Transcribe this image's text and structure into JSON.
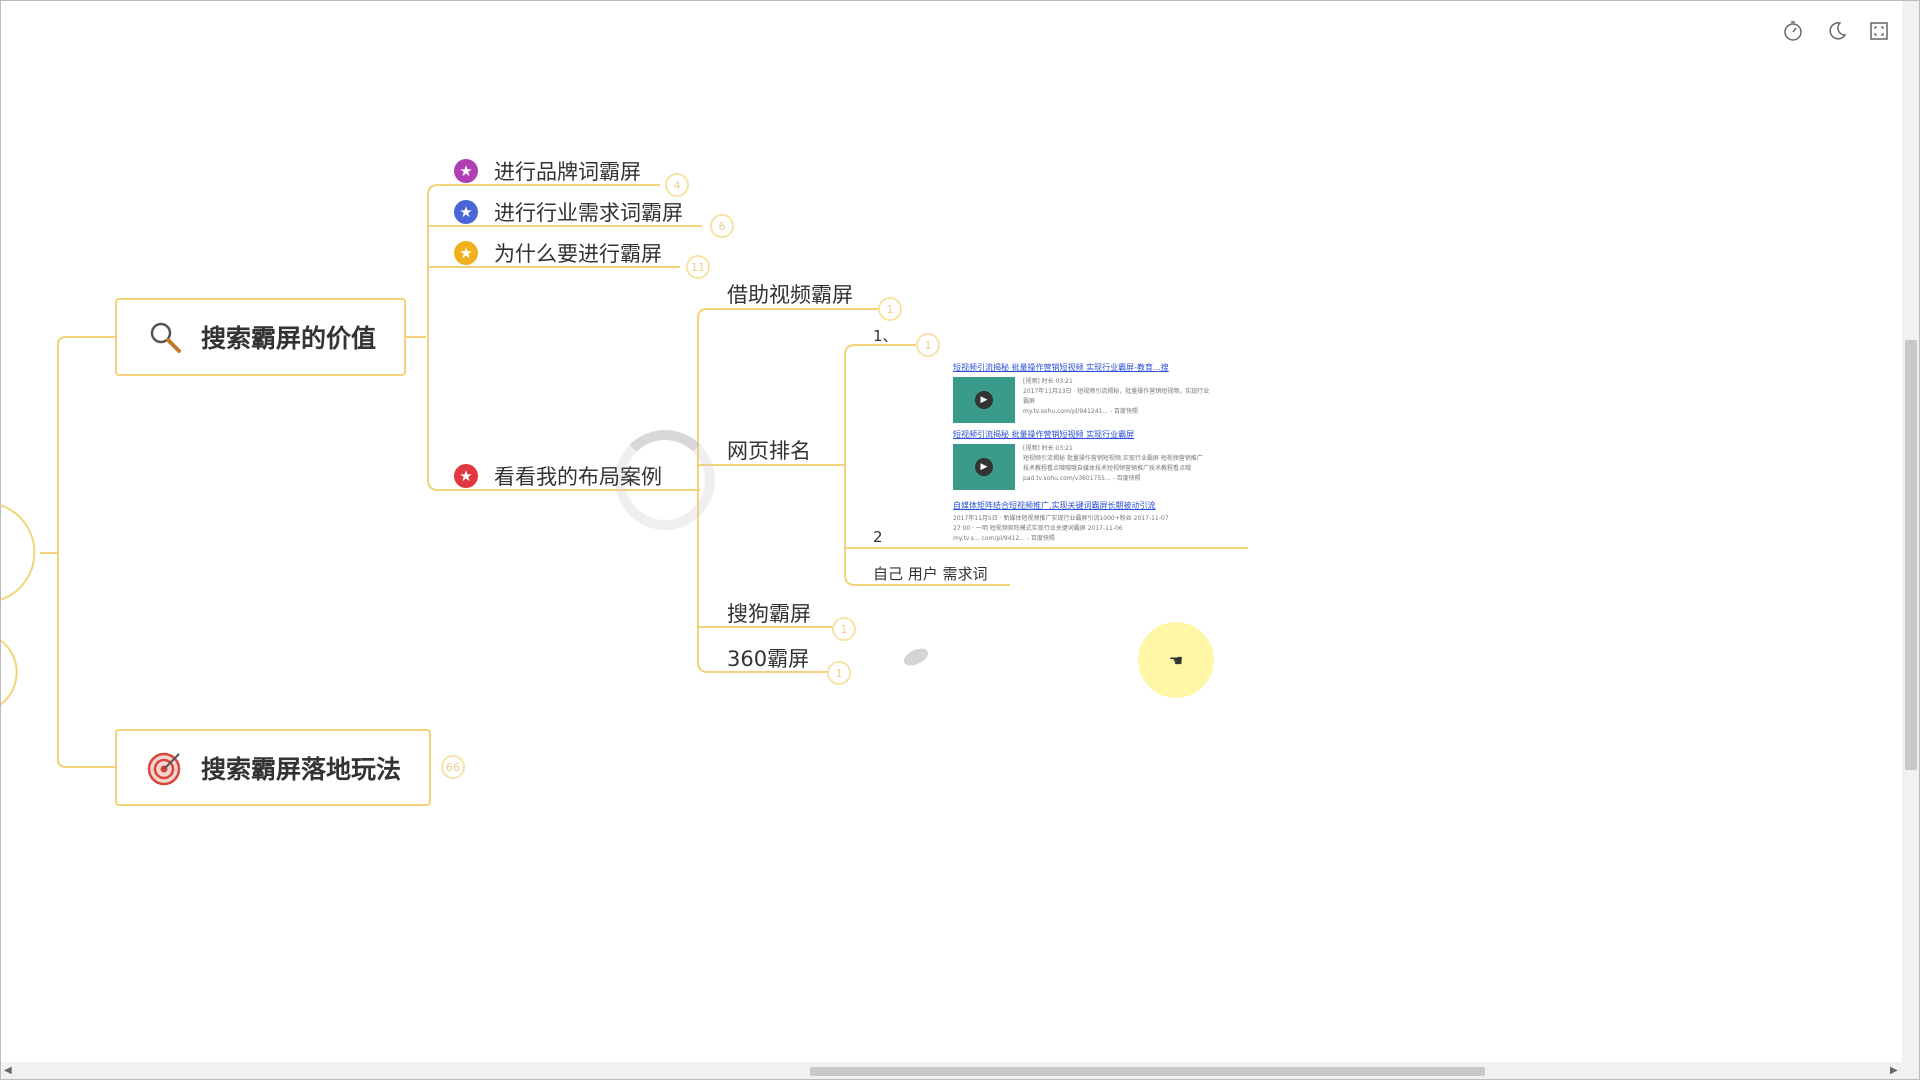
{
  "toolbar": {
    "timer_icon": "stopwatch-icon",
    "theme_icon": "moon-icon",
    "fullscreen_icon": "fullscreen-icon"
  },
  "mindmap": {
    "branch_color": "#f3d27a",
    "main_nodes": [
      {
        "label": "搜索霸屏的价值",
        "icon": "magnifier-icon"
      },
      {
        "label": "搜索霸屏落地玩法",
        "icon": "target-icon",
        "badge": "66"
      }
    ],
    "topics": [
      {
        "label": "进行品牌词霸屏",
        "badge": "4",
        "star_color": "#b03fb6"
      },
      {
        "label": "进行行业需求词霸屏",
        "badge": "6",
        "star_color": "#4a66d6"
      },
      {
        "label": "为什么要进行霸屏",
        "badge": "11",
        "star_color": "#f0b020"
      },
      {
        "label": "看看我的布局案例",
        "star_color": "#e0383e"
      }
    ],
    "case_children": [
      {
        "label": "借助视频霸屏",
        "badge": "1"
      },
      {
        "label": "网页排名"
      },
      {
        "label": "搜狗霸屏",
        "badge": "1"
      },
      {
        "label": "360霸屏",
        "badge": "1"
      }
    ],
    "webpage_children": [
      {
        "label": "1、",
        "badge": "1"
      },
      {
        "label": "2"
      },
      {
        "label": "自己  用户  需求词"
      }
    ]
  },
  "search_results": [
    {
      "title": "短视频引流揭秘 批量操作营销短视频 实现行业霸屏-教育...搜",
      "line1": "[视频] 时长 03:21",
      "line2": "2017年11月23日 · 短视频引流揭秘，批量操作营销短视频，实现行业",
      "line3": "霸屏",
      "url": "my.tv.sohu.com/pl/941241...  -  百度快照"
    },
    {
      "title": "短视频引流揭秘 批量操作营销短视频 实现行业霸屏",
      "line1": "[视频] 时长 03:21",
      "line2": "短视频引流揭秘 批量操作营销短视频,实现行业霸屏 短视频营销推广",
      "line3": "技术教程看点哦哦哦自媒体技术短视频营销推广技术教程看点哦",
      "url": "pad.tv.sohu.com/v3601755...  -  百度快照"
    },
    {
      "title": "自媒体矩阵结合短视频推广,实现关键词霸屏长期被动引流",
      "line1": "2017年11月5日 · 新媒体短视频推广实现行业霸屏引流1000+粉丝 2017-11-07",
      "line2": "27 00 · 一明 短视频矩阵模式实现行业关键词霸屏 2017-11-06",
      "line3": "",
      "url": "my.tv.s... com/pl/9412...  -  百度快照"
    }
  ]
}
